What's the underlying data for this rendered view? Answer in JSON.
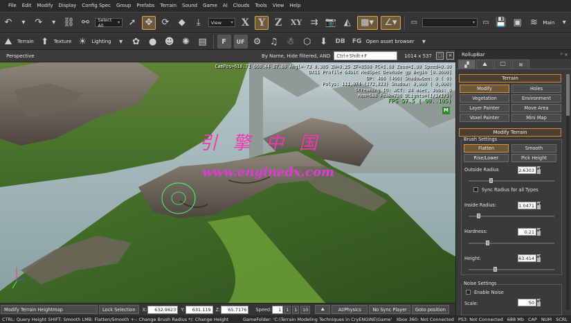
{
  "menubar": [
    "File",
    "Edit",
    "Modify",
    "Display",
    "Config Spec",
    "Group",
    "Prefabs",
    "Terrain",
    "Sound",
    "Game",
    "AI",
    "Clouds",
    "Tools",
    "View",
    "Help"
  ],
  "toolbar1": {
    "select_all": "Select All",
    "coord_system": "View",
    "axis_x": "X",
    "axis_y": "Y",
    "axis_z": "Z",
    "axis_xy": "XY",
    "right_label": "Main"
  },
  "toolbar2": {
    "terrain": "Terrain",
    "texture": "Texture",
    "lighting": "Lighting",
    "f_btn": "F",
    "uf_btn": "UF",
    "db": "DB",
    "fg": "FG",
    "asset_browser": "Open asset browser"
  },
  "viewport": {
    "title": "Perspective",
    "filter": "By Name, Hide filtered, AND",
    "search_placeholder": "Ctrl+Shift+F",
    "resolution": "1014 x 537",
    "stats": [
      "CamPos=616.71 660.44 87.80 Angl=-73  0.305 ZN=0.25 ZF=8500 FC=1.00 Zoom=1.00 Speed=0.00",
      "DX11 Profile 64bit MedSpec DevMode gp Begin [0.3600]",
      "DP: 466 (466) ShadowGen:  0 (  0)",
      "Polys: 111,074 (172,823) Shadow: 0,000 ( 0,000)",
      "Streaming IO: ACT: 24 msec, Jobs: 0",
      "Mem=688 Peak=786 DLights=(1/1/1/9)",
      "FPS  57.5 ( 90..105)"
    ],
    "mode_badge": "M",
    "watermark_cn": "引擎中国",
    "watermark_url": "www.enginedx.com"
  },
  "rollup": {
    "title": "RollupBar",
    "terrain_section": "Terrain",
    "terrain_buttons": [
      "Modify",
      "Holes",
      "Vegetation",
      "Environment",
      "Layer Painter",
      "Move Area",
      "Voxel Painter",
      "Mini Map"
    ],
    "modify_section": "Modify Terrain",
    "brush_settings": "Brush Settings",
    "brush_buttons": [
      "Flatten",
      "Smooth",
      "Rise/Lower",
      "Pick Height"
    ],
    "outside_radius_label": "Outside Radius",
    "outside_radius": "2.6303",
    "outside_radius_level": 0.25,
    "sync_radius": "Sync Radius for all Types",
    "inside_radius_label": "Inside Radius:",
    "inside_radius": "1.0471",
    "inside_radius_level": 0.1,
    "hardness_label": "Hardness:",
    "hardness": "0.21",
    "hardness_level": 0.21,
    "height_label": "Height:",
    "height": "63.414",
    "height_level": 0.3,
    "noise_settings": "Noise Settings",
    "enable_noise": "Enable Noise",
    "scale_label": "Scale:",
    "scale": "50"
  },
  "statusbar": {
    "mode": "Modify Terrain Heightmap",
    "lock": "Lock Selection",
    "x_label": "X:",
    "x": "632.9823",
    "y_label": "Y:",
    "y": "631.119",
    "z_label": "Z:",
    "z": "65.7176",
    "speed_label": "Speed:",
    "speed_value": "1",
    "speed_options": [
      "1",
      "1",
      "10"
    ],
    "ai_physics": "AI/Physics",
    "sync_player": "No Sync Player",
    "goto": "Goto position"
  },
  "hints": {
    "text": "CTRL: Query Height  SHIFT: Smooth  LMB: Flatten/Smooth  +-: Change Brush Radius  */: Change Height",
    "gamefolder": "GameFolder: 'C:\\Terrain Modeling Techniques in CryENGINE\\Game'",
    "xbox": "Xbox 360: Not Connected",
    "ps3": "PS3: Not Connected",
    "mem": "688 Mb",
    "cap": "CAP",
    "num": "NUM",
    "scrl": "SCRL"
  },
  "colors": {
    "accent": "#d88a3c",
    "fps": "#7cf07c",
    "watermark": "#e23ad8"
  }
}
